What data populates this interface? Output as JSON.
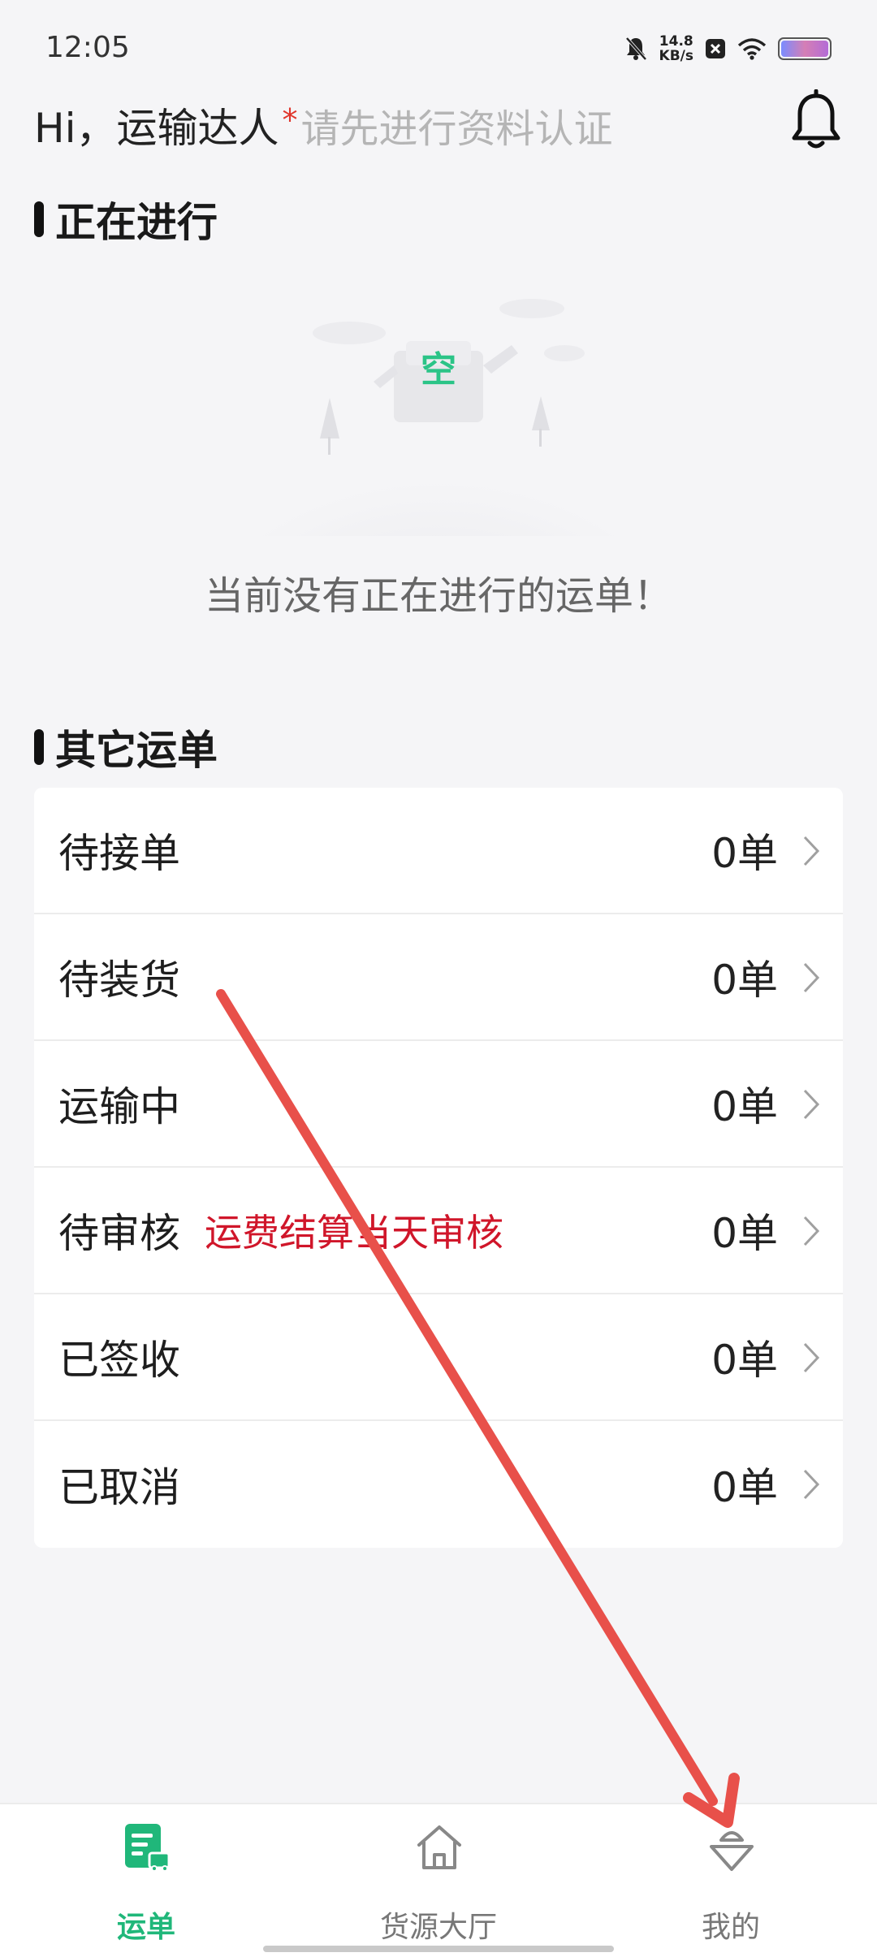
{
  "status_bar": {
    "time": "12:05",
    "speed_value": "14.8",
    "speed_unit": "KB/s"
  },
  "header": {
    "greeting": "Hi，运输达人",
    "required_mark": "*",
    "verify_prompt": "请先进行资料认证"
  },
  "in_progress": {
    "title": "正在进行",
    "empty_badge": "空",
    "empty_message": "当前没有正在进行的运单！"
  },
  "other_orders": {
    "title": "其它运单",
    "rows": [
      {
        "label": "待接单",
        "note": "",
        "count": "0单"
      },
      {
        "label": "待装货",
        "note": "",
        "count": "0单"
      },
      {
        "label": "运输中",
        "note": "",
        "count": "0单"
      },
      {
        "label": "待审核",
        "note": "运费结算当天审核",
        "count": "0单"
      },
      {
        "label": "已签收",
        "note": "",
        "count": "0单"
      },
      {
        "label": "已取消",
        "note": "",
        "count": "0单"
      }
    ]
  },
  "tab_bar": {
    "tabs": [
      {
        "label": "运单",
        "icon": "waybill-icon",
        "active": true
      },
      {
        "label": "货源大厅",
        "icon": "home-icon",
        "active": false
      },
      {
        "label": "我的",
        "icon": "profile-icon",
        "active": false
      }
    ]
  },
  "colors": {
    "accent": "#20b77a",
    "warning_text": "#d0162a",
    "annotation_arrow": "#e8504a"
  }
}
